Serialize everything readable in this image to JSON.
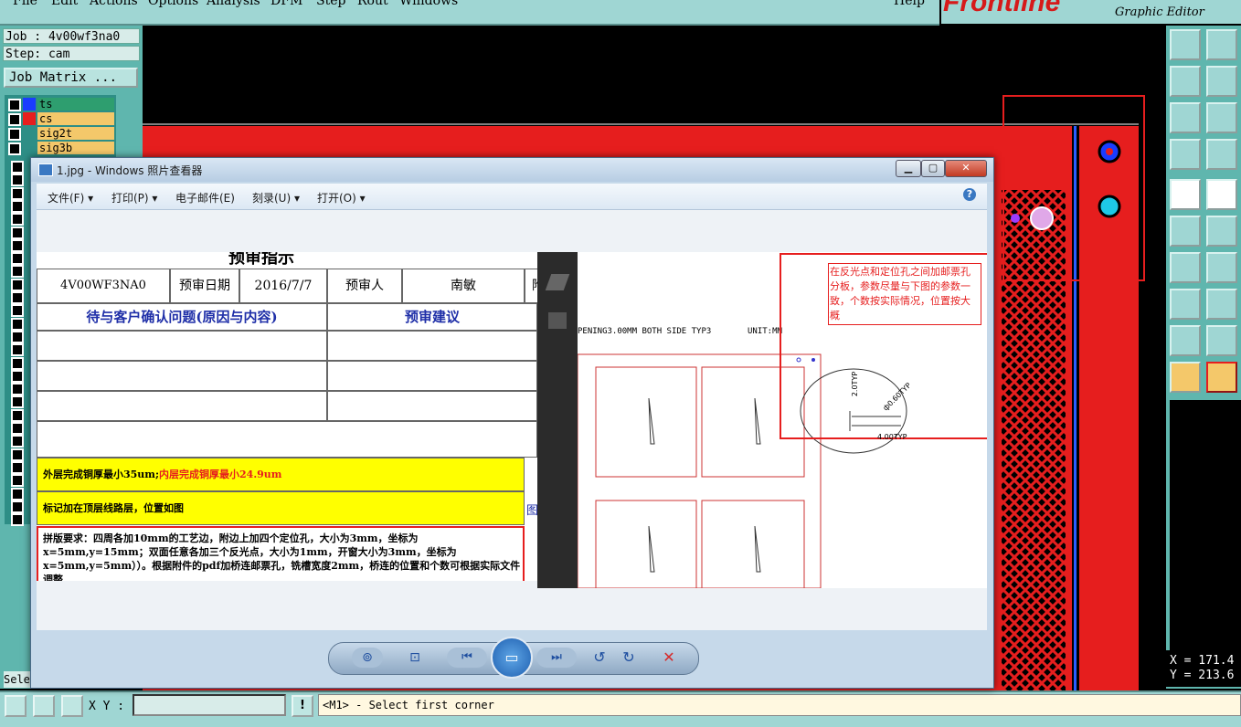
{
  "app": {
    "menu": [
      "File",
      "Edit",
      "Actions",
      "Options",
      "Analysis",
      "DFM",
      "Step",
      "Rout",
      "Windows",
      "Help"
    ],
    "brand": "Frontline",
    "editor_title": "Graphic Editor"
  },
  "left_panel": {
    "job_label": "Job : 4v00wf3na0",
    "step_label": "Step: cam",
    "job_matrix_button": "Job Matrix ...",
    "layers": [
      {
        "name": "ts",
        "swatch": "#1a3cff",
        "bg": "#2e9e6f"
      },
      {
        "name": "cs",
        "swatch": "#e61e1e",
        "bg": "#f4c86a"
      },
      {
        "name": "sig2t",
        "swatch": "#2e8e86",
        "bg": "#f4c86a"
      },
      {
        "name": "sig3b",
        "swatch": "#2e8e86",
        "bg": "#f4c86a"
      }
    ],
    "select_label": "Sele"
  },
  "bottom_bar": {
    "xy_label": "X Y :",
    "xy_value": "",
    "status_text": "<M1> - Select first corner"
  },
  "coords": {
    "x": "X = 171.4",
    "y": "Y = 213.6"
  },
  "viewer": {
    "title": "1.jpg - Windows 照片查看器",
    "menu": [
      "文件(F) ▾",
      "打印(P) ▾",
      "电子邮件(E)",
      "刻录(U) ▾",
      "打开(O) ▾"
    ],
    "help": "?",
    "doc": {
      "heading": "预审指示",
      "row1": [
        "4V00WF3NA0",
        "预审日期",
        "2016/7/7",
        "预审人",
        "南敏",
        "附"
      ],
      "row2": [
        "待与客户确认问题(原因与内容)",
        "预审建议"
      ],
      "yellow1_a": "外层完成铜厚最小35um;",
      "yellow1_b": "内层完成铜厚最小24.9um",
      "yellow2": "标记加在顶层线路层，位置如图",
      "yellow2_side": "图",
      "notes": "拼版要求：四周各加10mm的工艺边，附边上加四个定位孔，大小为3mm，坐标为x=5mm,y=15mm；双面任意各加三个反光点，大小为1mm，开窗大小为3mm，坐标为x=5mm,y=5mm））。根据附件的pdf加桥连邮票孔，铣槽宽度2mm，桥连的位置和个数可根据实际文件调整"
    },
    "drawing": {
      "caption": "PENING3.00MM BOTH SIDE TYP3",
      "unit": "UNIT:MM",
      "annotation": "在反光点和定位孔之间加邮票孔分板，参数尽量与下图的参数一致，个数按实际情况，位置按大概",
      "detail_labels": [
        "2.0TYP",
        "ф0.60TYP",
        "4.00TYP"
      ]
    }
  }
}
